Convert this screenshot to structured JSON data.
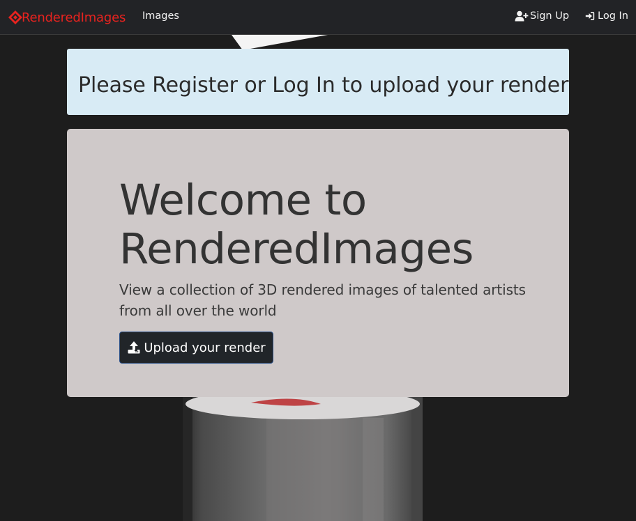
{
  "navbar": {
    "brand": "RenderedImages",
    "links": {
      "images": "Images",
      "sign_up": "Sign Up",
      "log_in": "Log In"
    },
    "brand_color": "#e8231f",
    "background": "#222326"
  },
  "alert": {
    "message": "Please Register or Log In to upload your render",
    "background": "#d8ebf5"
  },
  "hero": {
    "title": "Welcome to RenderedImages",
    "lead": "View a collection of 3D rendered images of talented artists from all over the world",
    "button_label": "Upload your render",
    "background": "#cfc9c9"
  },
  "icons": {
    "brand": "render-logo-icon",
    "sign_up": "user-plus-icon",
    "log_in": "sign-in-icon",
    "upload": "upload-icon"
  }
}
